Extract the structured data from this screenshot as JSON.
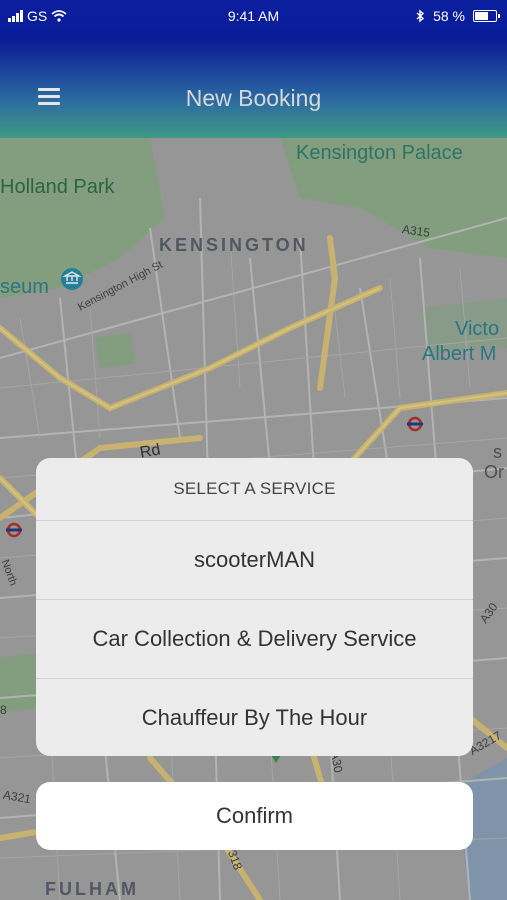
{
  "status_bar": {
    "carrier": "GS",
    "time": "9:41 AM",
    "battery": "58 %"
  },
  "header": {
    "title": "New Booking"
  },
  "map": {
    "labels": {
      "kensington_palace": "Kensington Palace",
      "holland_park": "Holland Park",
      "kensington": "KENSINGTON",
      "a315": "A315",
      "museum": "seum",
      "kensington_high_st": "Kensington High St",
      "victoria": "Victo",
      "albert": "Albert M",
      "rd": "Rd",
      "s": "s",
      "or": "Or",
      "north": "North",
      "a3217": "A3217",
      "a321": "A321",
      "a30": "A30",
      "a308": "A30",
      "num_318": "318",
      "num_8": "8",
      "fulham": "FULHAM"
    }
  },
  "action_sheet": {
    "heading": "SELECT A SERVICE",
    "options": [
      "scooterMAN",
      "Car Collection & Delivery Service",
      "Chauffeur By The Hour"
    ],
    "confirm_label": "Confirm"
  }
}
